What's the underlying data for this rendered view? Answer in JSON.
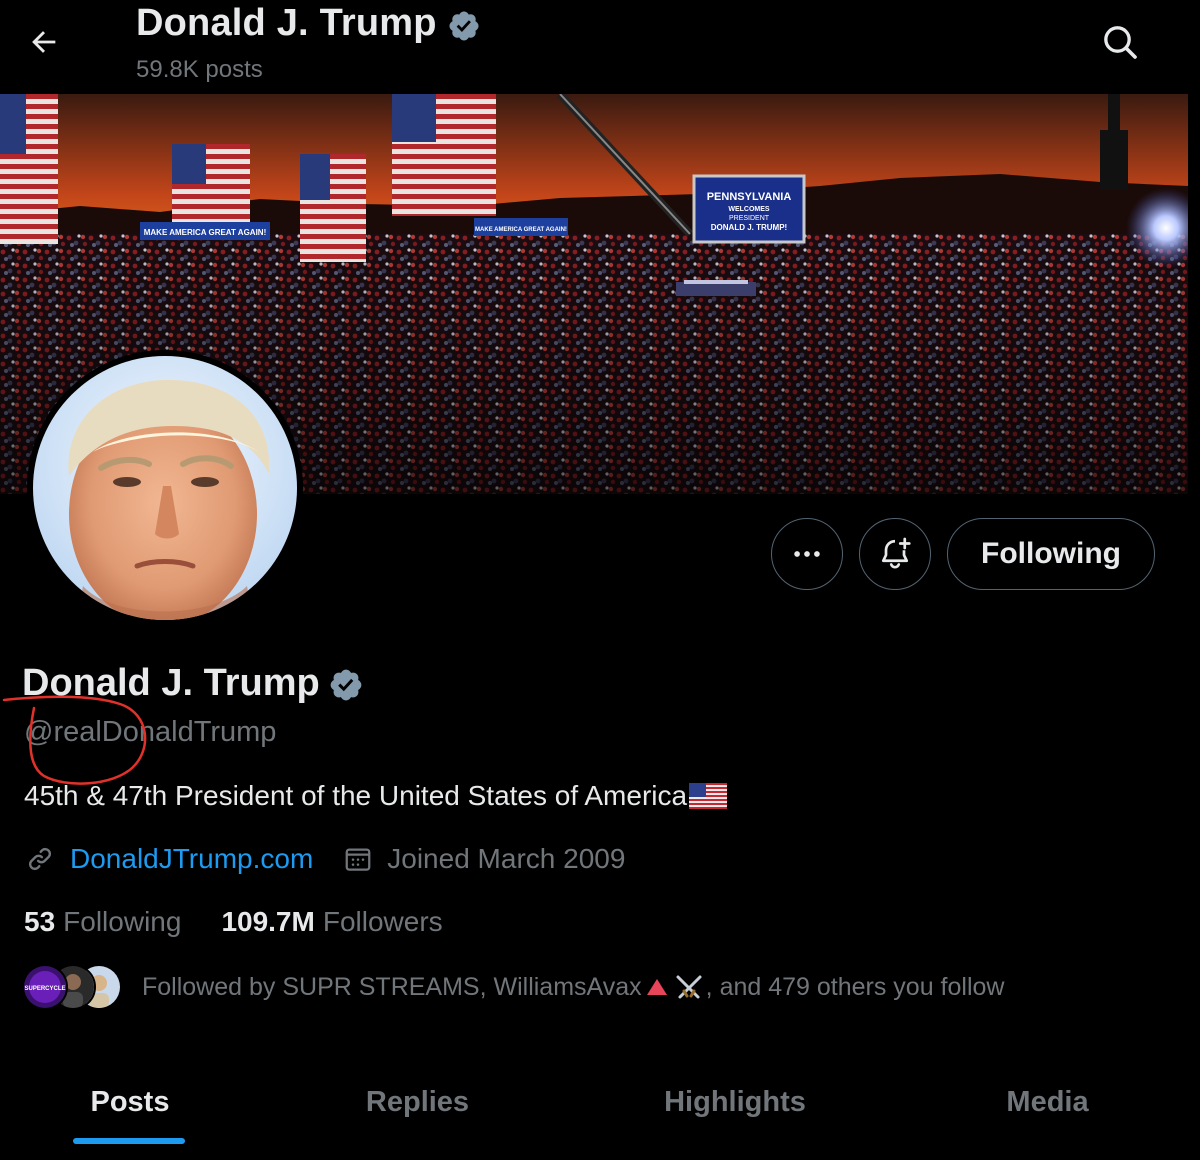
{
  "header": {
    "name": "Donald J. Trump",
    "posts_count": "59.8K posts"
  },
  "banner": {
    "banner_left_sign": "MAKE AMERICA GREAT AGAIN!",
    "banner_mid_sign": "MAKE AMERICA GREAT AGAIN!",
    "screen_line1": "PENNSYLVANIA",
    "screen_line2": "WELCOMES",
    "screen_line3": "PRESIDENT",
    "screen_line4": "DONALD J. TRUMP!"
  },
  "actions": {
    "following_label": "Following"
  },
  "profile": {
    "name": "Donald J. Trump",
    "handle": "@realDonaldTrump",
    "bio": "45th & 47th President of the United States of America",
    "website": "DonaldJTrump.com",
    "joined": "Joined March 2009"
  },
  "stats": {
    "following_count": "53",
    "following_label": "Following",
    "followers_count": "109.7M",
    "followers_label": "Followers"
  },
  "followed_by": {
    "prefix": "Followed by SUPR STREAMS, WilliamsAvax",
    "suffix": ", and 479 others you follow",
    "avatar_1_text": "SUPERCYCLE"
  },
  "tabs": [
    {
      "label": "Posts",
      "active": true
    },
    {
      "label": "Replies",
      "active": false
    },
    {
      "label": "Highlights",
      "active": false
    },
    {
      "label": "Media",
      "active": false
    }
  ],
  "colors": {
    "accent": "#1d9bf0",
    "verified": "#829aab",
    "muted_text": "#71767b",
    "annotation": "#e0312a"
  },
  "icons": {
    "back": "arrow-left-icon",
    "search": "search-icon",
    "verified": "verified-badge-icon",
    "more": "more-horizontal-icon",
    "notify": "bell-plus-icon",
    "link": "link-icon",
    "calendar": "calendar-icon"
  }
}
